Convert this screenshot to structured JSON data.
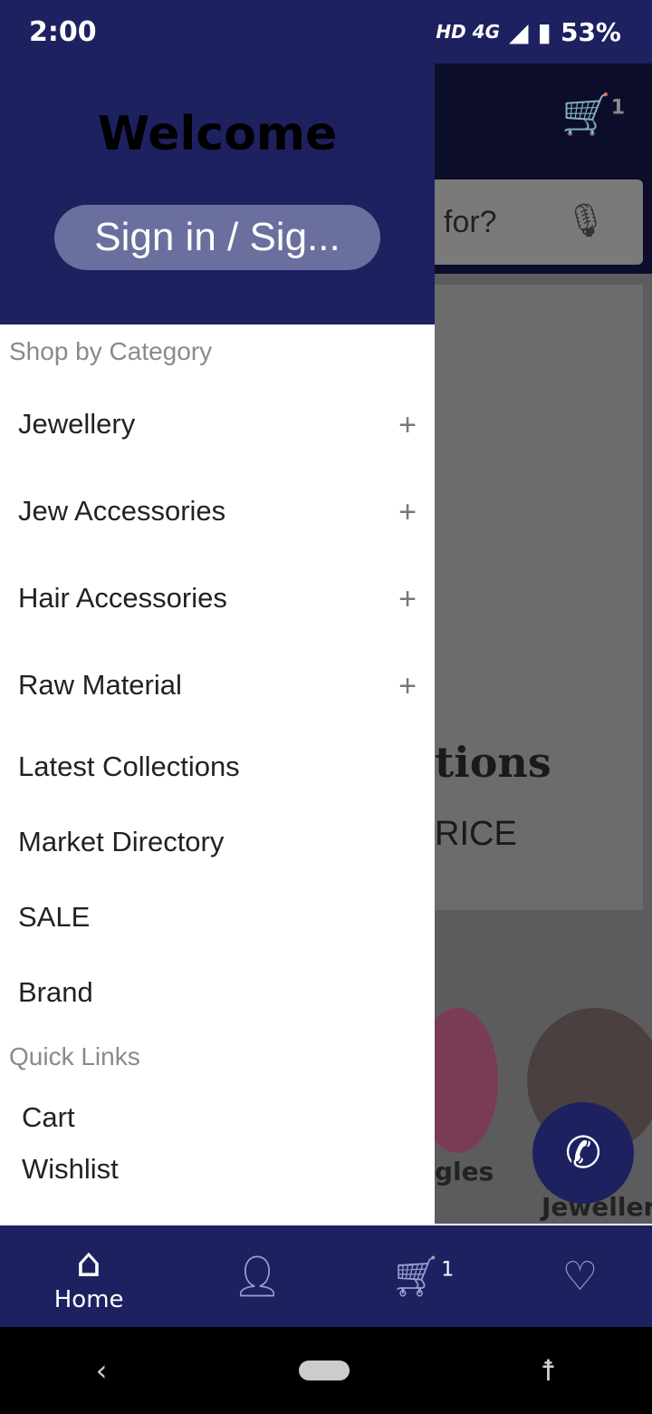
{
  "status": {
    "time": "2:00",
    "network": "HD 4G",
    "battery": "53%"
  },
  "background": {
    "cart_badge": "1",
    "search_placeholder": "for?",
    "banner_title": "tions",
    "banner_subtitle": "RICE",
    "category_1": "gles",
    "category_2": "Jewellery"
  },
  "drawer": {
    "welcome": "Welcome",
    "signin": "Sign in / Sig...",
    "section_category": "Shop by Category",
    "categories": [
      {
        "label": "Jewellery"
      },
      {
        "label": "Jew Accessories"
      },
      {
        "label": "Hair Accessories"
      },
      {
        "label": "Raw Material"
      },
      {
        "label": "Latest Collections"
      },
      {
        "label": "Market Directory"
      },
      {
        "label": "SALE"
      },
      {
        "label": "Brand"
      }
    ],
    "section_quick": "Quick Links",
    "quick": [
      {
        "label": "Cart"
      },
      {
        "label": "Wishlist"
      }
    ],
    "plus": "+"
  },
  "nav": {
    "home": "Home",
    "cart_badge": "1"
  },
  "colors": {
    "primary": "#1e2160"
  }
}
